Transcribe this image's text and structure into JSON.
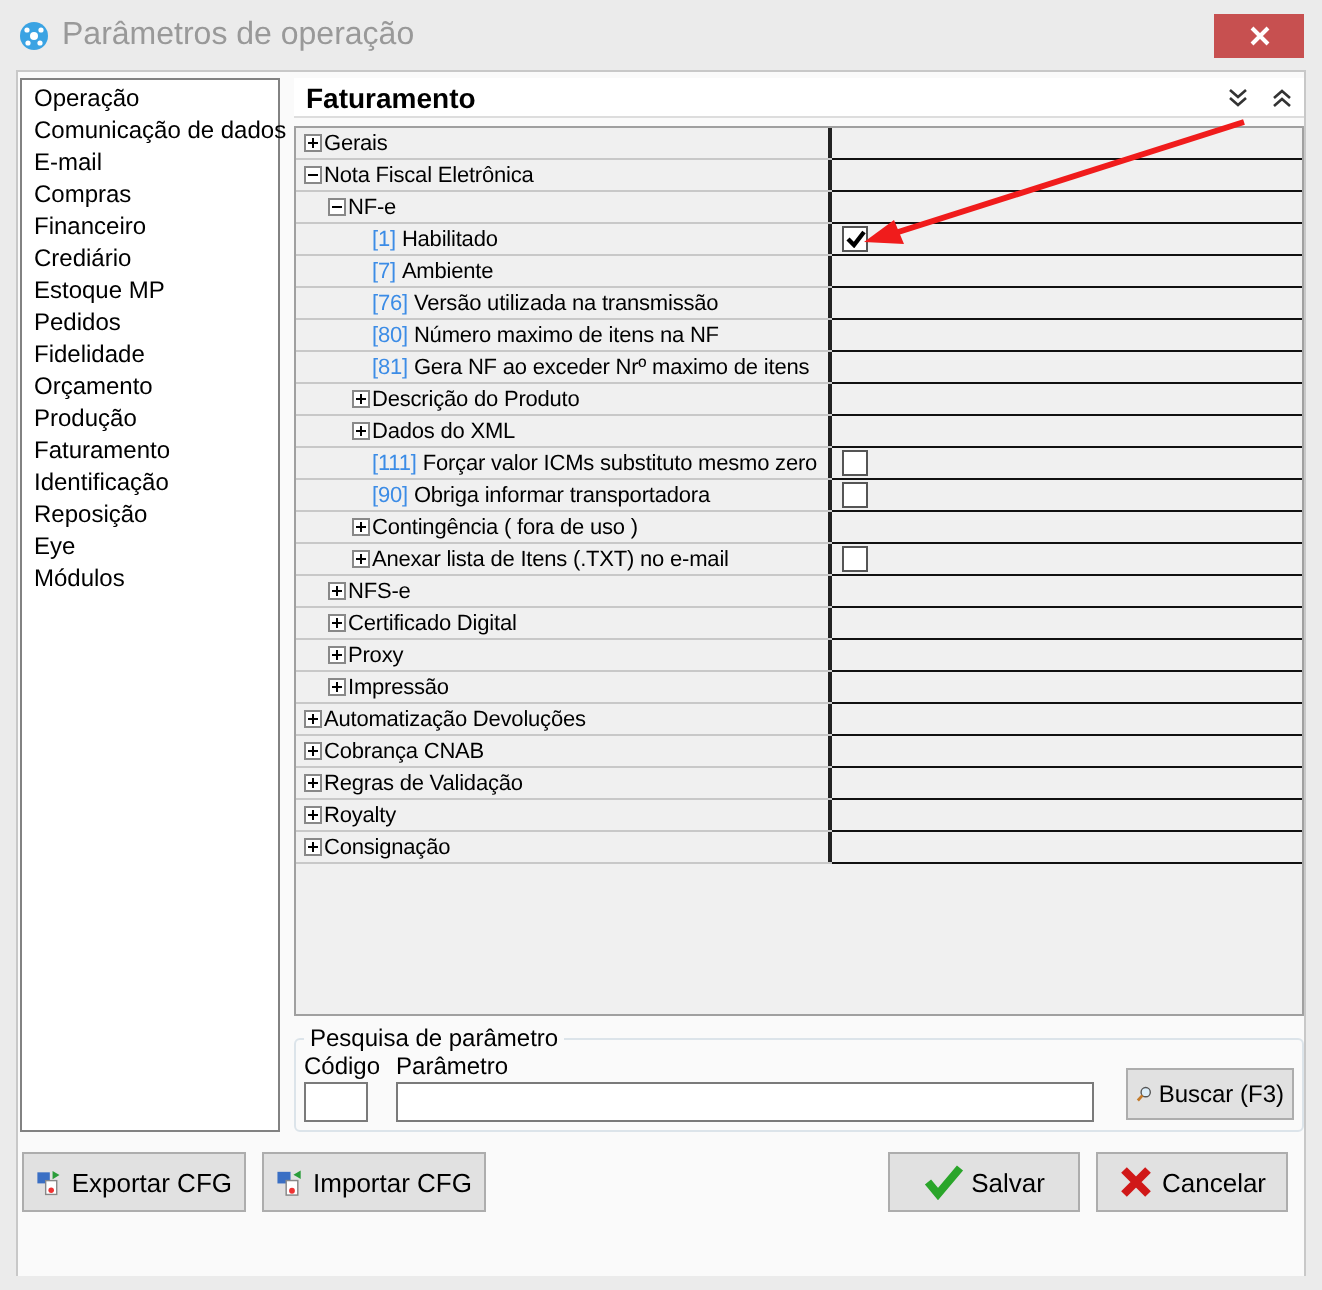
{
  "window": {
    "title": "Parâmetros de operação"
  },
  "sidebar": {
    "items": [
      "Operação",
      "Comunicação de dados",
      "E-mail",
      "Compras",
      "Financeiro",
      "Crediário",
      "Estoque MP",
      "Pedidos",
      "Fidelidade",
      "Orçamento",
      "Produção",
      "Faturamento",
      "Identificação",
      "Reposição",
      "Eye",
      "Módulos"
    ]
  },
  "panel": {
    "title": "Faturamento"
  },
  "tree": [
    {
      "label": "Gerais",
      "expanded": false
    },
    {
      "label": "Nota Fiscal Eletrônica",
      "expanded": true,
      "children": [
        {
          "label": "NF-e",
          "expanded": true,
          "children": [
            {
              "code": "[1]",
              "label": "Habilitado",
              "checkbox": {
                "checked": true
              }
            },
            {
              "code": "[7]",
              "label": "Ambiente"
            },
            {
              "code": "[76]",
              "label": "Versão utilizada na transmissão"
            },
            {
              "code": "[80]",
              "label": "Número maximo de itens na NF"
            },
            {
              "code": "[81]",
              "label": "Gera NF ao exceder Nrº maximo de itens"
            },
            {
              "label": "Descrição do Produto",
              "expanded": false
            },
            {
              "label": "Dados do XML",
              "expanded": false
            },
            {
              "code": "[111]",
              "label": "Forçar valor ICMs substituto mesmo zero",
              "checkbox": {
                "checked": false
              }
            },
            {
              "code": "[90]",
              "label": "Obriga informar transportadora",
              "checkbox": {
                "checked": false
              }
            },
            {
              "label": "Contingência ( fora de uso )",
              "expanded": false
            },
            {
              "label": "Anexar lista de Itens (.TXT) no e-mail",
              "expanded": false,
              "checkbox": {
                "checked": false
              }
            }
          ]
        },
        {
          "label": "NFS-e",
          "expanded": false
        },
        {
          "label": "Certificado Digital",
          "expanded": false
        },
        {
          "label": "Proxy",
          "expanded": false
        },
        {
          "label": "Impressão",
          "expanded": false
        }
      ]
    },
    {
      "label": "Automatização Devoluções",
      "expanded": false
    },
    {
      "label": "Cobrança CNAB",
      "expanded": false
    },
    {
      "label": "Regras de Validação",
      "expanded": false
    },
    {
      "label": "Royalty",
      "expanded": false
    },
    {
      "label": "Consignação",
      "expanded": false
    }
  ],
  "search": {
    "title": "Pesquisa de parâmetro",
    "code_label": "Código",
    "param_label": "Parâmetro",
    "button": "Buscar (F3)"
  },
  "buttons": [
    {
      "kind": "export",
      "label": "Exportar CFG"
    },
    {
      "kind": "import",
      "label": "Importar CFG"
    },
    {
      "kind": "save",
      "label": "Salvar"
    },
    {
      "kind": "cancel",
      "label": "Cancelar"
    }
  ]
}
